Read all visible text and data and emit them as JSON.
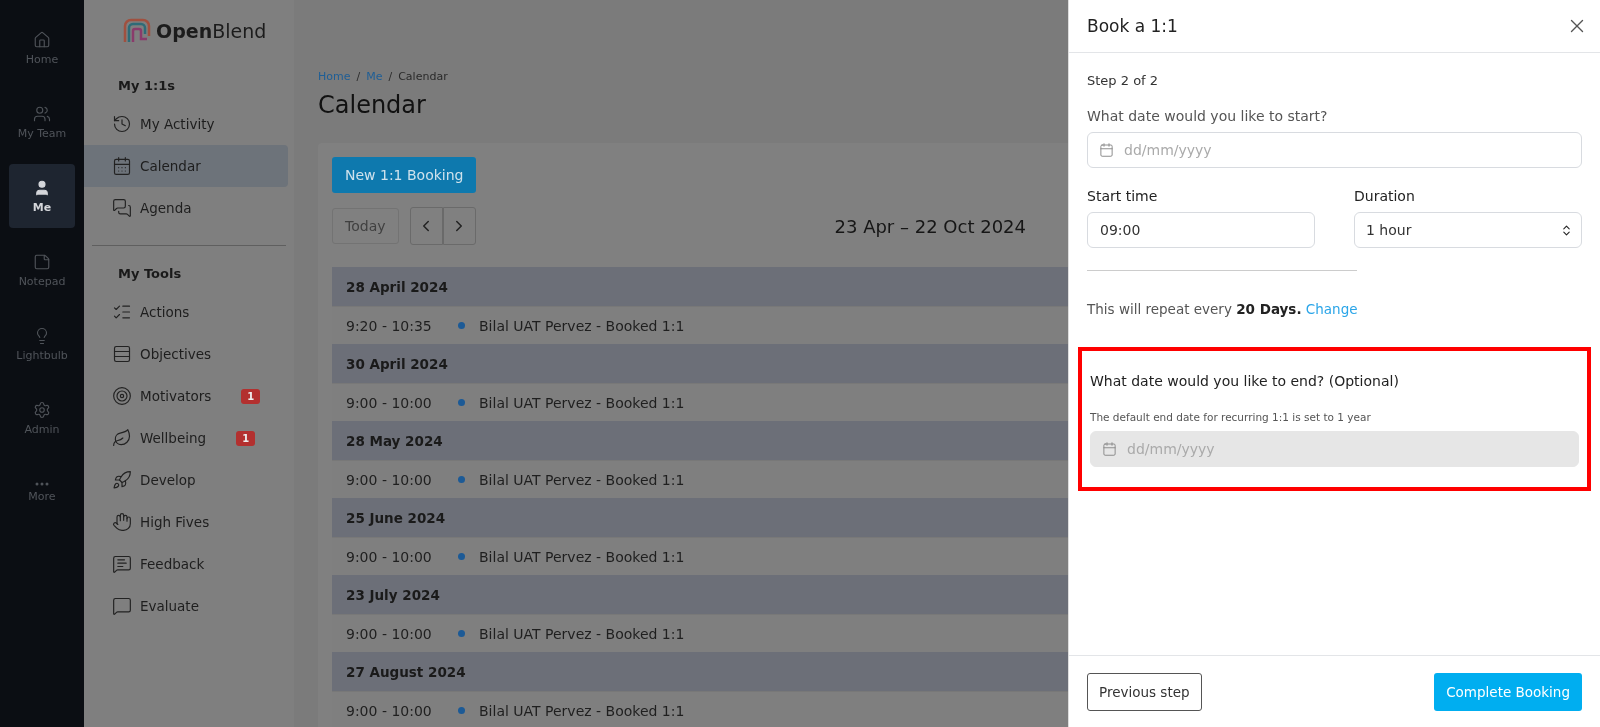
{
  "rail": {
    "items": [
      {
        "label": "Home",
        "selected": false
      },
      {
        "label": "My Team",
        "selected": false
      },
      {
        "label": "Me",
        "selected": true
      },
      {
        "label": "Notepad",
        "selected": false
      },
      {
        "label": "Lightbulb",
        "selected": false
      },
      {
        "label": "Admin",
        "selected": false
      },
      {
        "label": "More",
        "selected": false
      }
    ]
  },
  "sidebar": {
    "logo": "**Open**Blend",
    "sections": [
      {
        "title": "My 1:1s",
        "items": [
          {
            "label": "My Activity",
            "selected": false
          },
          {
            "label": "Calendar",
            "selected": true
          },
          {
            "label": "Agenda",
            "selected": false
          }
        ]
      },
      {
        "title": "My Tools",
        "items": [
          {
            "label": "Actions",
            "selected": false
          },
          {
            "label": "Objectives",
            "selected": false
          },
          {
            "label": "Motivators",
            "selected": false,
            "badge": "1"
          },
          {
            "label": "Wellbeing",
            "selected": false,
            "badge": "1"
          },
          {
            "label": "Develop",
            "selected": false
          },
          {
            "label": "High Fives",
            "selected": false
          },
          {
            "label": "Feedback",
            "selected": false
          },
          {
            "label": "Evaluate",
            "selected": false
          }
        ]
      }
    ]
  },
  "breadcrumb": [
    {
      "kind": "link",
      "text": "Home"
    },
    {
      "kind": "separator",
      "text": "/"
    },
    {
      "kind": "link",
      "text": "Me"
    },
    {
      "kind": "separator",
      "text": "/"
    },
    {
      "kind": "current",
      "text": "Calendar"
    }
  ],
  "page_title": "Calendar",
  "calendar": {
    "new_button": "New 1:1 Booking",
    "today_button": "Today",
    "range": "23 Apr – 22 Oct 2024",
    "days": [
      {
        "date": "28 April 2024",
        "events": [
          {
            "time": "9:20 - 10:35",
            "title": "Bilal UAT Pervez - Booked 1:1"
          }
        ]
      },
      {
        "date": "30 April 2024",
        "events": [
          {
            "time": "9:00 - 10:00",
            "title": "Bilal UAT Pervez - Booked 1:1"
          }
        ]
      },
      {
        "date": "28 May 2024",
        "events": [
          {
            "time": "9:00 - 10:00",
            "title": "Bilal UAT Pervez - Booked 1:1"
          }
        ]
      },
      {
        "date": "25 June 2024",
        "events": [
          {
            "time": "9:00 - 10:00",
            "title": "Bilal UAT Pervez - Booked 1:1"
          }
        ]
      },
      {
        "date": "23 July 2024",
        "events": [
          {
            "time": "9:00 - 10:00",
            "title": "Bilal UAT Pervez - Booked 1:1"
          }
        ]
      },
      {
        "date": "27 August 2024",
        "events": [
          {
            "time": "9:00 - 10:00",
            "title": "Bilal UAT Pervez - Booked 1:1"
          }
        ]
      }
    ]
  },
  "dialog": {
    "title": "Book a 1:1",
    "step": "Step 2 of 2",
    "start_date": {
      "label": "What date would you like to start?",
      "placeholder": "dd/mm/yyyy",
      "disabled": false
    },
    "start_time": {
      "label": "Start time",
      "value": "09:00"
    },
    "duration": {
      "label": "Duration",
      "value": "1 hour"
    },
    "repeat": {
      "text": "This will repeat every **20 Days.**",
      "link": "Change"
    },
    "end_section": {
      "highlighted": true,
      "label": "What date would you like to end? (Optional)",
      "hint": "The default end date for recurring 1:1 is set to 1 year",
      "end_date": {
        "placeholder": "dd/mm/yyyy",
        "disabled": true
      }
    },
    "buttons": {
      "previous": "Previous step",
      "complete": "Complete Booking"
    }
  }
}
